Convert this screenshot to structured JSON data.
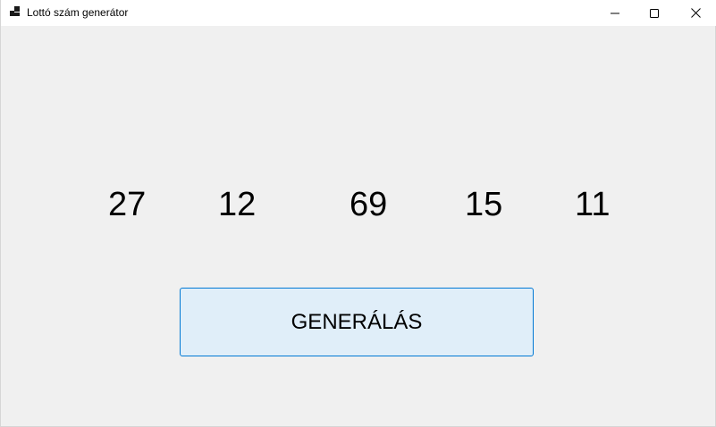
{
  "window": {
    "title": "Lottó szám generátor",
    "controls": {
      "minimize": "minimize-icon",
      "maximize": "maximize-icon",
      "close": "close-icon"
    }
  },
  "lotto": {
    "numbers": [
      "27",
      "12",
      "69",
      "15",
      "11"
    ]
  },
  "generate_button": {
    "label": "GENERÁLÁS"
  },
  "colors": {
    "window_background": "#f0f0f0",
    "button_background": "#e0eef9",
    "button_border": "#0078d4"
  }
}
